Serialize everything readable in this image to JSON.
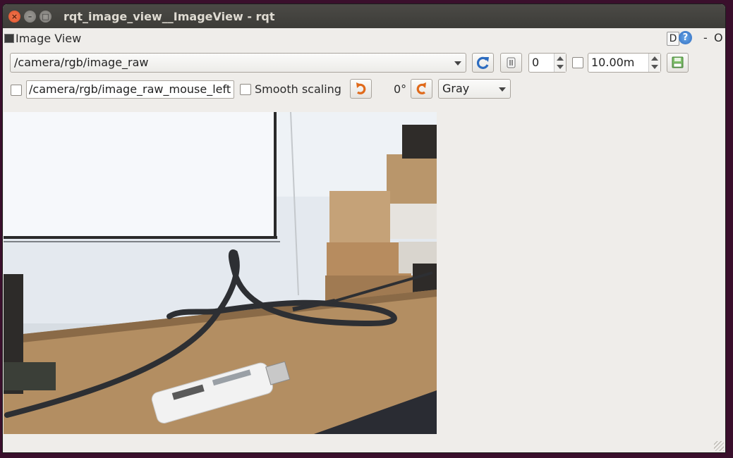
{
  "window": {
    "title": "rqt_image_view__ImageView - rqt",
    "close_glyph": "×",
    "min_glyph": "–",
    "max_glyph": "□"
  },
  "dock": {
    "title": "Image View",
    "d_label": "D",
    "help_label": "?",
    "dash_label": "-",
    "o_label": "O"
  },
  "toolbar": {
    "topic": "/camera/rgb/image_raw",
    "spin_value": "0",
    "duration_value": "10.00m"
  },
  "row2": {
    "mouse_topic": "/camera/rgb/image_raw_mouse_left",
    "smooth_scaling_label": "Smooth scaling",
    "rotation_label": "0°",
    "colormap": "Gray"
  },
  "icons": {
    "refresh": "refresh-icon",
    "pause": "pause-icon",
    "save": "save-icon",
    "rotate_left": "rotate-left-icon",
    "rotate_right": "rotate-right-icon"
  },
  "colors": {
    "titlebar": "#3d3c38",
    "window_bg": "#efedea",
    "accent_orange": "#e06a1b",
    "accent_blue": "#2d6cc0"
  }
}
